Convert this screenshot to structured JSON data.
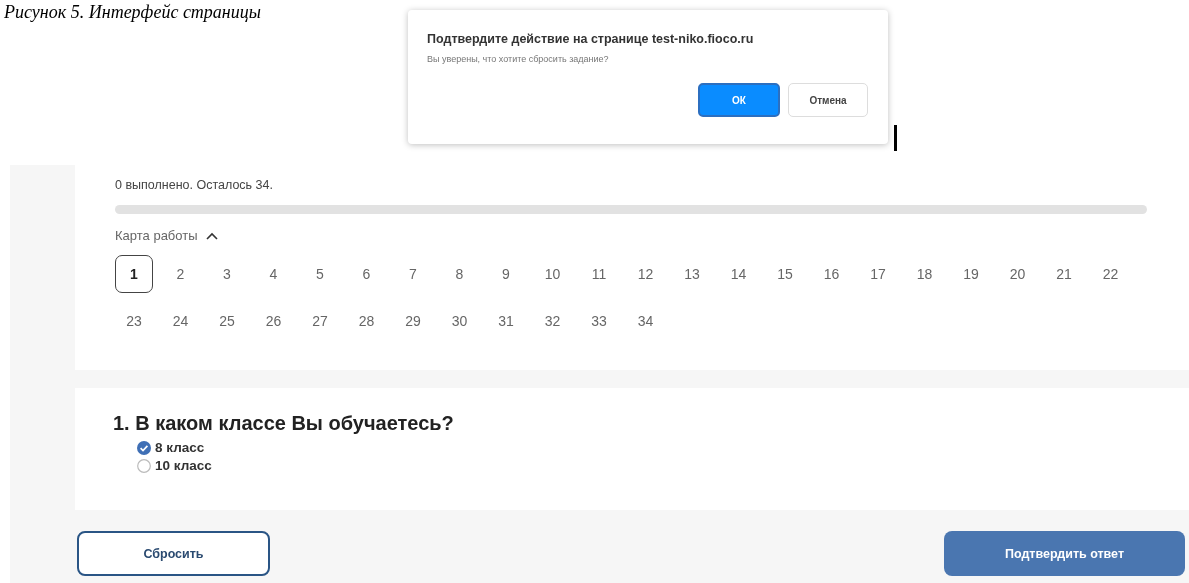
{
  "caption": "Рисунок 5. Интерфейс страницы",
  "dialog": {
    "title": "Подтвердите действие на странице test-niko.fioco.ru",
    "message": "Вы уверены, что хотите сбросить задание?",
    "buttons": [
      {
        "label": "ОК",
        "kind": "primary"
      },
      {
        "label": "Отмена",
        "kind": "secondary"
      }
    ]
  },
  "progress": {
    "text": "0 выполнено. Осталось 34.",
    "level": 0
  },
  "work_map": {
    "label": "Карта работы",
    "expanded": true,
    "items": [
      {
        "label": "1",
        "selected": true
      },
      {
        "label": "2",
        "selected": false
      },
      {
        "label": "3",
        "selected": false
      },
      {
        "label": "4",
        "selected": false
      },
      {
        "label": "5",
        "selected": false
      },
      {
        "label": "6",
        "selected": false
      },
      {
        "label": "7",
        "selected": false
      },
      {
        "label": "8",
        "selected": false
      },
      {
        "label": "9",
        "selected": false
      },
      {
        "label": "10",
        "selected": false
      },
      {
        "label": "11",
        "selected": false
      },
      {
        "label": "12",
        "selected": false
      },
      {
        "label": "13",
        "selected": false
      },
      {
        "label": "14",
        "selected": false
      },
      {
        "label": "15",
        "selected": false
      },
      {
        "label": "16",
        "selected": false
      },
      {
        "label": "17",
        "selected": false
      },
      {
        "label": "18",
        "selected": false
      },
      {
        "label": "19",
        "selected": false
      },
      {
        "label": "20",
        "selected": false
      },
      {
        "label": "21",
        "selected": false
      },
      {
        "label": "22",
        "selected": false
      },
      {
        "label": "23",
        "selected": false
      },
      {
        "label": "24",
        "selected": false
      },
      {
        "label": "25",
        "selected": false
      },
      {
        "label": "26",
        "selected": false
      },
      {
        "label": "27",
        "selected": false
      },
      {
        "label": "28",
        "selected": false
      },
      {
        "label": "29",
        "selected": false
      },
      {
        "label": "30",
        "selected": false
      },
      {
        "label": "31",
        "selected": false
      },
      {
        "label": "32",
        "selected": false
      },
      {
        "label": "33",
        "selected": false
      },
      {
        "label": "34",
        "selected": false
      }
    ]
  },
  "question": {
    "title": "1. В каком классе Вы обучаетесь?",
    "options": [
      {
        "label": "8 класс",
        "selected": true
      },
      {
        "label": "10 класс",
        "selected": false
      }
    ]
  },
  "buttons": [
    {
      "label": "Сбросить",
      "kind": "secondary"
    },
    {
      "label": "Подтвердить ответ",
      "kind": "primary"
    }
  ]
}
